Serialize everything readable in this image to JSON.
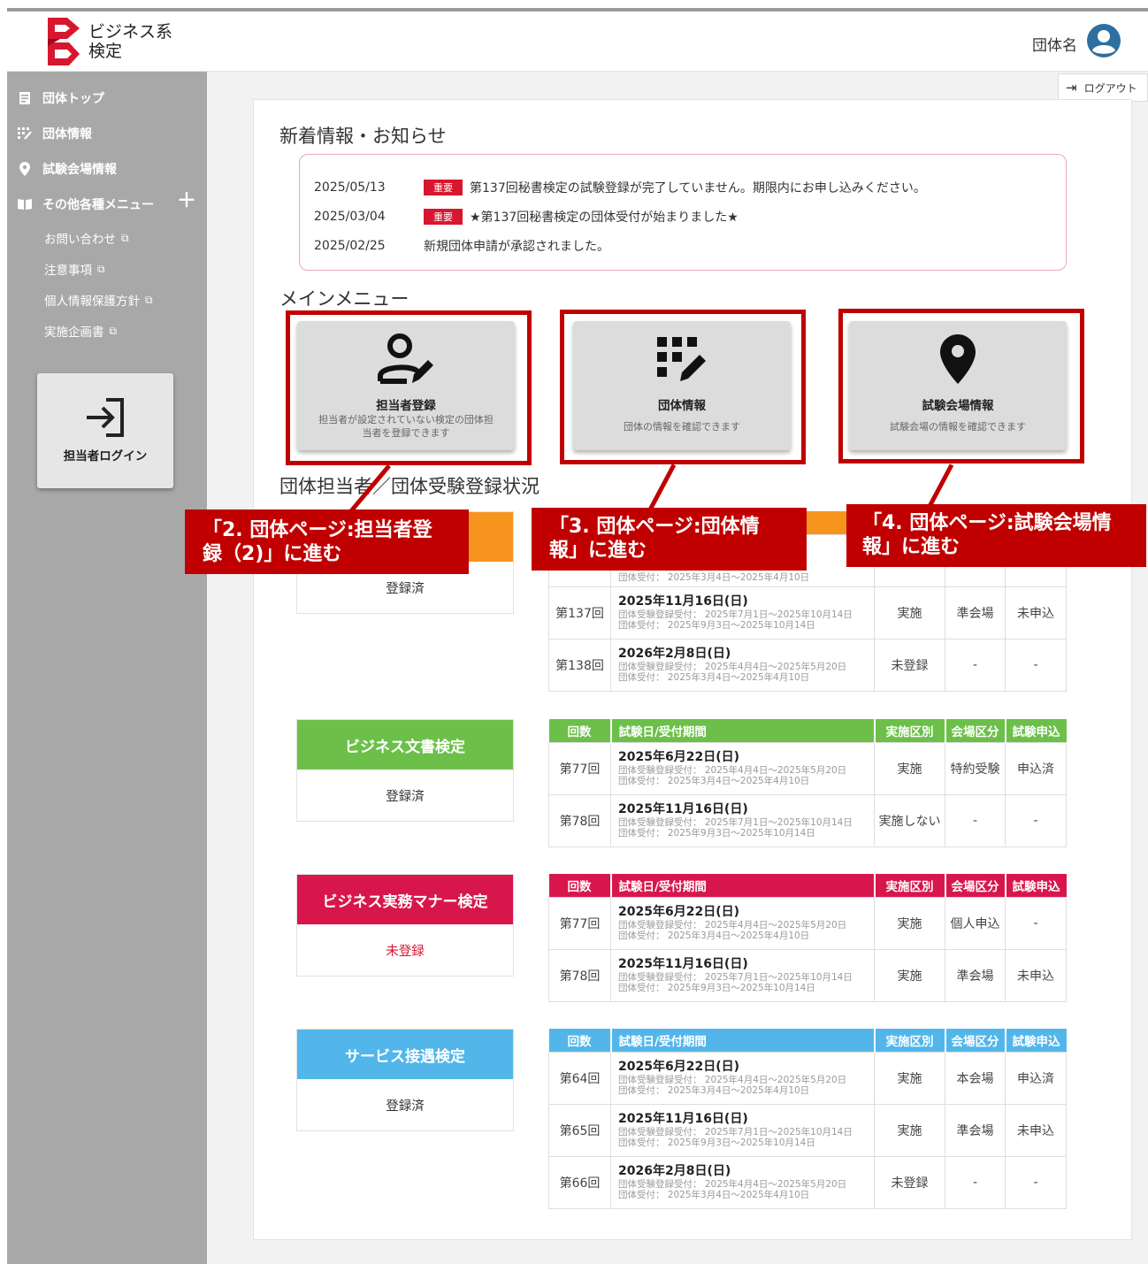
{
  "header": {
    "logo_line1": "ビジネス系",
    "logo_line2": "検定",
    "org_name": "団体名"
  },
  "sidebar": {
    "items": [
      {
        "icon": "document-list-icon",
        "label": "団体トップ"
      },
      {
        "icon": "edit-grid-icon",
        "label": "団体情報"
      },
      {
        "icon": "location-pin-icon",
        "label": "試験会場情報"
      },
      {
        "icon": "book-icon",
        "label": "その他各種メニュー"
      }
    ],
    "sub_items": [
      {
        "label": "お問い合わせ"
      },
      {
        "label": "注意事項"
      },
      {
        "label": "個人情報保護方針"
      },
      {
        "label": "実施企画書"
      }
    ],
    "login_button": "担当者ログイン"
  },
  "logout_label": "ログアウト",
  "news": {
    "title": "新着情報・お知らせ",
    "badge_label": "重要",
    "items": [
      {
        "date": "2025/05/13",
        "important": true,
        "text": "第137回秘書検定の試験登録が完了していません。期限内にお申し込みください。"
      },
      {
        "date": "2025/03/04",
        "important": true,
        "text": "★第137回秘書検定の団体受付が始まりました★"
      },
      {
        "date": "2025/02/25",
        "important": false,
        "text": "新規団体申請が承認されました。"
      }
    ]
  },
  "main_menu": {
    "title": "メインメニュー",
    "cards": [
      {
        "icon": "person-edit-icon",
        "title": "担当者登録",
        "desc": "担当者が設定されていない検定の団体担当者を登録できます"
      },
      {
        "icon": "edit-grid-icon",
        "title": "団体情報",
        "desc": "団体の情報を確認できます"
      },
      {
        "icon": "location-pin-icon",
        "title": "試験会場情報",
        "desc": "試験会場の情報を確認できます"
      }
    ]
  },
  "callouts": [
    {
      "line1": "「2. 団体ページ:担当者登",
      "line2": "録（2)」に進む"
    },
    {
      "line1": "「3. 団体ページ:団体情",
      "line2": "報」に進む"
    },
    {
      "line1": "「4. 団体ページ:試験会場情",
      "line2": "報」に進む"
    }
  ],
  "status_title": "団体担当者／団体受験登録状況",
  "table_headers": [
    "回数",
    "試験日/受付期間",
    "実施区別",
    "会場区分",
    "試験申込"
  ],
  "sections": [
    {
      "name": "",
      "status": "登録済",
      "rows": [
        {
          "round": "",
          "date": "",
          "sub1": "",
          "sub2": "団体受付： 2025年3月4日～2025年4月10日",
          "kubun": "",
          "venue": "",
          "apply": ""
        },
        {
          "round": "第137回",
          "date": "2025年11月16日(日)",
          "sub1": "団体受験登録受付： 2025年7月1日～2025年10月14日",
          "sub2": "団体受付： 2025年9月3日～2025年10月14日",
          "kubun": "実施",
          "venue": "準会場",
          "apply": "未申込"
        },
        {
          "round": "第138回",
          "date": "2026年2月8日(日)",
          "sub1": "団体受験登録受付： 2025年4月4日～2025年5月20日",
          "sub2": "団体受付： 2025年3月4日～2025年4月10日",
          "kubun": "未登録",
          "venue": "-",
          "apply": "-"
        }
      ]
    },
    {
      "name": "ビジネス文書検定",
      "status": "登録済",
      "rows": [
        {
          "round": "第77回",
          "date": "2025年6月22日(日)",
          "sub1": "団体受験登録受付： 2025年4月4日～2025年5月20日",
          "sub2": "団体受付： 2025年3月4日～2025年4月10日",
          "kubun": "実施",
          "venue": "特約受験",
          "apply": "申込済"
        },
        {
          "round": "第78回",
          "date": "2025年11月16日(日)",
          "sub1": "団体受験登録受付： 2025年7月1日～2025年10月14日",
          "sub2": "団体受付： 2025年9月3日～2025年10月14日",
          "kubun": "実施しない",
          "venue": "-",
          "apply": "-"
        }
      ]
    },
    {
      "name": "ビジネス実務マナー検定",
      "status": "未登録",
      "rows": [
        {
          "round": "第77回",
          "date": "2025年6月22日(日)",
          "sub1": "団体受験登録受付： 2025年4月4日～2025年5月20日",
          "sub2": "団体受付： 2025年3月4日～2025年4月10日",
          "kubun": "実施",
          "venue": "個人申込",
          "apply": "-"
        },
        {
          "round": "第78回",
          "date": "2025年11月16日(日)",
          "sub1": "団体受験登録受付： 2025年7月1日～2025年10月14日",
          "sub2": "団体受付： 2025年9月3日～2025年10月14日",
          "kubun": "実施",
          "venue": "準会場",
          "apply": "未申込"
        }
      ]
    },
    {
      "name": "サービス接遇検定",
      "status": "登録済",
      "rows": [
        {
          "round": "第64回",
          "date": "2025年6月22日(日)",
          "sub1": "団体受験登録受付： 2025年4月4日～2025年5月20日",
          "sub2": "団体受付： 2025年3月4日～2025年4月10日",
          "kubun": "実施",
          "venue": "本会場",
          "apply": "申込済"
        },
        {
          "round": "第65回",
          "date": "2025年11月16日(日)",
          "sub1": "団体受験登録受付： 2025年7月1日～2025年10月14日",
          "sub2": "団体受付： 2025年9月3日～2025年10月14日",
          "kubun": "実施",
          "venue": "準会場",
          "apply": "未申込"
        },
        {
          "round": "第66回",
          "date": "2026年2月8日(日)",
          "sub1": "団体受験登録受付： 2025年4月4日～2025年5月20日",
          "sub2": "団体受付： 2025年3月4日～2025年4月10日",
          "kubun": "未登録",
          "venue": "-",
          "apply": "-"
        }
      ]
    }
  ],
  "colors": {
    "sidebar_bg": "#a8a8a8",
    "brand_red": "#d7172f",
    "callout_red": "#c00000",
    "section_orange": "#f7941d",
    "section_green": "#6cc04a",
    "section_crimson": "#d7174b",
    "section_blue": "#52b6ea",
    "status_unregistered": "#d7172f"
  }
}
